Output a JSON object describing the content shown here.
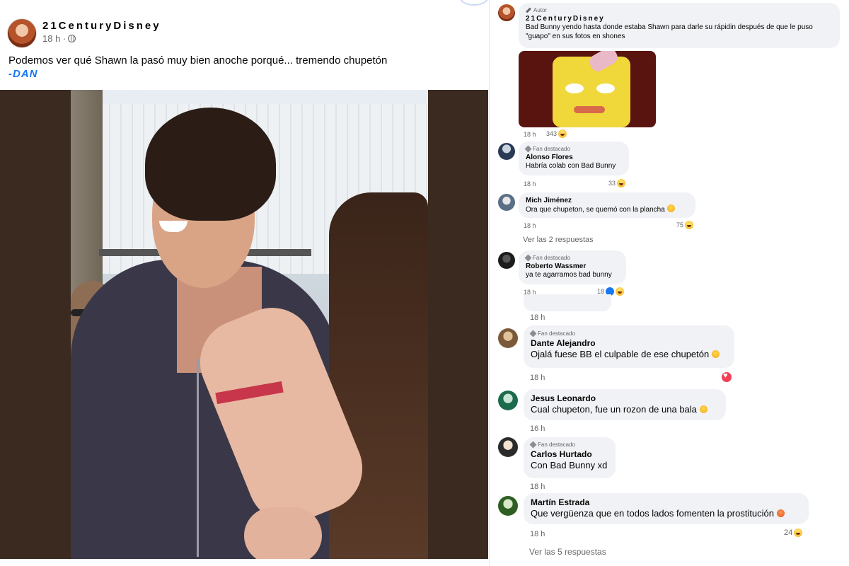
{
  "post": {
    "page_name": "21CenturyDisney",
    "time": "18 h ·",
    "text": "Podemos ver qué Shawn la pasó muy bien anoche porqué... tremendo chupetón",
    "signature": "-DAN"
  },
  "comments": [
    {
      "badge": "Autor",
      "name": "21CenturyDisney",
      "text": "Bad Bunny yendo hasta donde estaba Shawn para darle su rápidin después de que le puso \"guapo\" en sus fotos en shones",
      "time": "18 h",
      "reactions": "343"
    },
    {
      "badge": "Fan destacado",
      "name": "Alonso Flores",
      "text": "Habría colab con Bad Bunny",
      "time": "18 h",
      "reactions": "33"
    },
    {
      "name": "Mich Jiménez",
      "text": "Ora que chupeton, se quemó con la plancha",
      "time": "18 h",
      "reactions": "75",
      "more_replies": "Ver las 2 respuestas"
    },
    {
      "badge": "Fan destacado",
      "name": "Roberto Wassmer",
      "text": "ya te agarramos bad bunny",
      "time": "18 h",
      "reactions": "18"
    },
    {
      "time": "18 h"
    },
    {
      "badge": "Fan destacado",
      "name": "Dante Alejandro",
      "text": "Ojalá fuese BB el culpable de ese chupetón",
      "time": "18 h"
    },
    {
      "name": "Jesus Leonardo",
      "text": "Cual chupeton, fue un rozon de una bala",
      "time": "16 h"
    },
    {
      "badge": "Fan destacado",
      "name": "Carlos Hurtado",
      "text": "Con Bad Bunny xd",
      "time": "18 h"
    },
    {
      "name": "Martín Estrada",
      "text": "Que vergüenza que en todos lados fomenten la prostitución",
      "time": "18 h",
      "reactions": "24",
      "more_replies": "Ver las 5 respuestas"
    }
  ],
  "icons": {
    "globe": "globe-icon",
    "haha": "haha-reaction-icon",
    "like": "like-reaction-icon",
    "love": "heart-reaction-icon",
    "fan_badge": "diamond-icon",
    "author_badge": "pen-icon"
  },
  "colors": {
    "link_blue": "#1877f2",
    "bubble_bg": "#f0f2f5",
    "meta_gray": "#65676b"
  }
}
